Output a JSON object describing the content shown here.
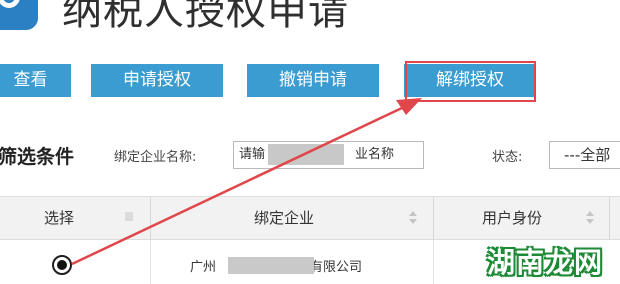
{
  "header": {
    "title": "纳税人授权申请"
  },
  "toolbar": {
    "view_label": "查看",
    "apply_label": "申请授权",
    "revoke_label": "撤销申请",
    "unbind_label": "解绑授权",
    "button_color": "#3a9cd0",
    "highlight_color": "#e0464a"
  },
  "filter": {
    "title": "筛选条件",
    "company_label": "绑定企业名称:",
    "company_placeholder": "请输",
    "company_placeholder_end": "业名称",
    "status_label": "状态:",
    "status_value": "---全部"
  },
  "table": {
    "columns": [
      "选择",
      "绑定企业",
      "用户身份"
    ],
    "rows": [
      {
        "selected": true,
        "company_prefix": "广州",
        "company_suffix": "有限公司"
      }
    ]
  },
  "watermark": {
    "text": "湖南龙网",
    "color": "#1d8a35"
  },
  "annotation": {
    "arrow_color": "#e0464a"
  }
}
